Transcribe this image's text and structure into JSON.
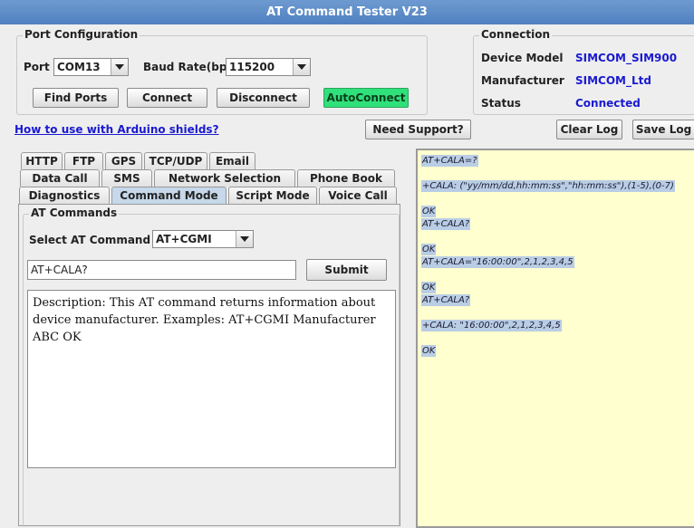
{
  "window": {
    "title": "AT Command Tester V23"
  },
  "port_config": {
    "title": "Port Configuration",
    "port_label": "Port",
    "port_value": "COM13",
    "baud_label": "Baud Rate(bps)",
    "baud_value": "115200",
    "find_ports": "Find Ports",
    "connect": "Connect",
    "disconnect": "Disconnect",
    "autoconnect": "AutoConnect"
  },
  "connection": {
    "title": "Connection",
    "device_model_label": "Device Model",
    "device_model_value": "SIMCOM_SIM900",
    "manufacturer_label": "Manufacturer",
    "manufacturer_value": "SIMCOM_Ltd",
    "status_label": "Status",
    "status_value": "Connected"
  },
  "toolbar": {
    "arduino_link": "How to use with Arduino shields?",
    "need_support": "Need Support?",
    "clear_log": "Clear Log",
    "save_log": "Save Log"
  },
  "tabs": {
    "row1": [
      "HTTP",
      "FTP",
      "GPS",
      "TCP/UDP",
      "Email"
    ],
    "row2": [
      "Data Call",
      "SMS",
      "Network Selection",
      "Phone Book"
    ],
    "row3": [
      "Diagnostics",
      "Command Mode",
      "Script Mode",
      "Voice Call"
    ],
    "active": "Command Mode"
  },
  "at_commands": {
    "title": "AT Commands",
    "select_label": "Select AT Command",
    "select_value": "AT+CGMI",
    "command_input": "AT+CALA?",
    "submit": "Submit",
    "description": "Description: This AT command returns information about device manufacturer. Examples: AT+CGMI Manufacturer ABC OK"
  },
  "log": {
    "lines": [
      "AT+CALA=?",
      "+CALA: (\"yy/mm/dd,hh:mm:ss\",\"hh:mm:ss\"),(1-5),(0-7)",
      "OK",
      "AT+CALA?",
      "OK",
      "AT+CALA=\"16:00:00\",2,1,2,3,4,5",
      "OK",
      "AT+CALA?",
      "+CALA: \"16:00:00\",2,1,2,3,4,5",
      "OK"
    ]
  },
  "colors": {
    "title_bar": "#5a8ac6",
    "autoconnect": "#30e07a",
    "value_text": "#1a1ad0",
    "log_background": "#ffffcf",
    "log_highlight": "#b9cde5"
  }
}
